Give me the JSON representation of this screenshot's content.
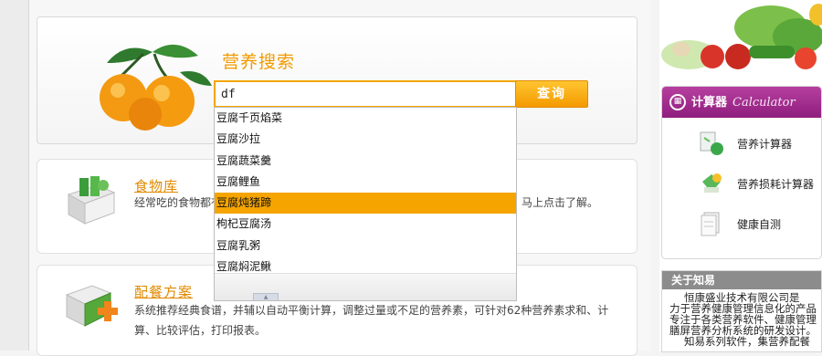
{
  "search": {
    "title": "营养搜索",
    "query": "df",
    "button": "查询",
    "suggestions": [
      "豆腐千页焰菜",
      "豆腐沙拉",
      "豆腐蔬菜羹",
      "豆腐鲤鱼",
      "豆腐炖猪蹄",
      "枸杞豆腐汤",
      "豆腐乳粥",
      "豆腐焖泥鳅"
    ],
    "active_index": 4
  },
  "cards": {
    "food": {
      "title": "食物库",
      "desc": "经常吃的食物都有",
      "desc_tail": "马上点击了解。"
    },
    "meal": {
      "title": "配餐方案",
      "desc": "系统推荐经典食谱，并辅以自动平衡计算，调整过量或不足的营养素，可针对62种营养素求和、计算、比较评估，打印报表。"
    }
  },
  "calculator": {
    "title": "计算器",
    "title_en": "Calculator",
    "items": [
      "营养计算器",
      "营养损耗计算器",
      "健康自测"
    ]
  },
  "about": {
    "title": "关于知易",
    "lines": [
      "恒康盛业技术有限公司是",
      "力于营养健康管理信息化的产品",
      "专注于各类营养软件、健康管理",
      "膳屏营养分析系统的研发设计。",
      "知易系列软件，集营养配餐"
    ]
  },
  "colors": {
    "accent_orange": "#f5a400",
    "title_orange": "#f29a00",
    "calc_purple": "#9c2688",
    "about_gray": "#8c8c8c"
  }
}
